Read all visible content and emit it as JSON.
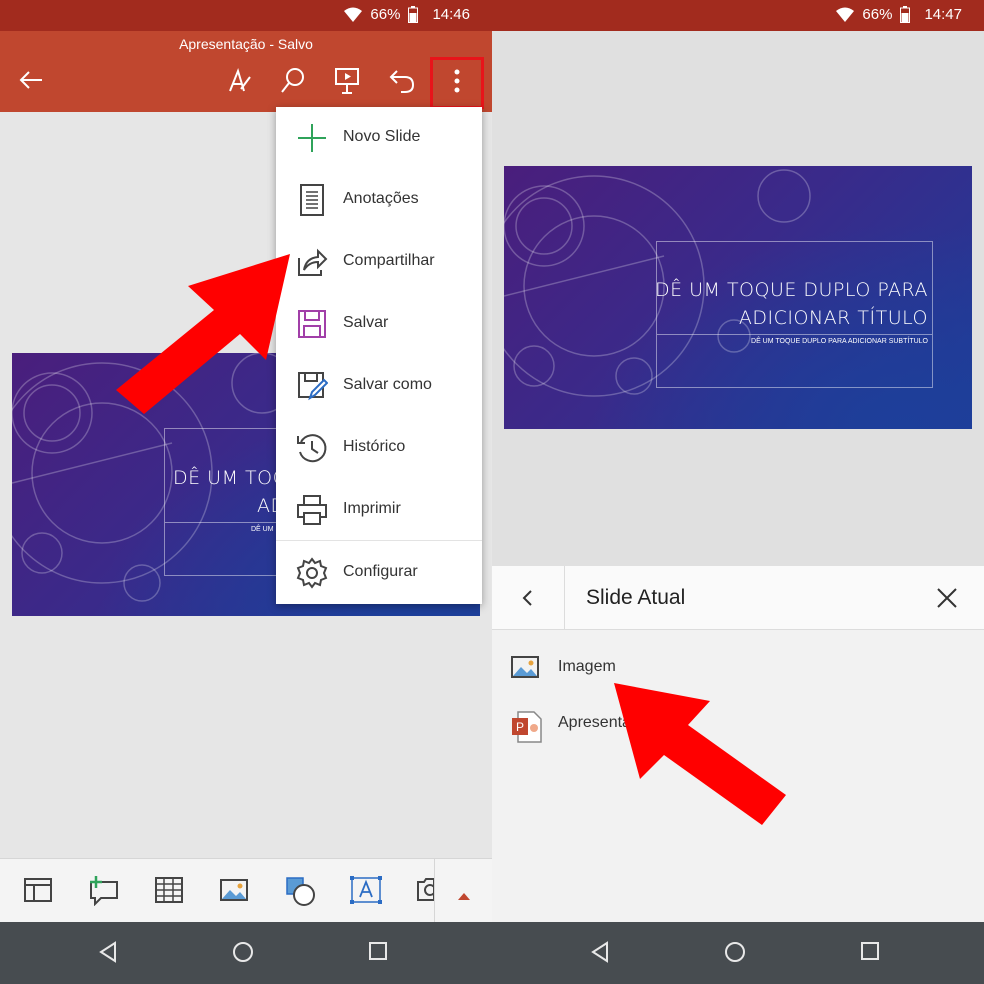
{
  "left_screen": {
    "status_bar": {
      "battery": "66%",
      "time": "14:46"
    },
    "app_bar": {
      "doc_title": "Apresentação - Salvo"
    },
    "slide": {
      "title_line1": "DÊ UM TOC",
      "title_line2": "AD",
      "subtitle": "DÊ UM"
    },
    "menu": {
      "items": [
        {
          "label": "Novo Slide",
          "icon": "plus-icon"
        },
        {
          "label": "Anotações",
          "icon": "notes-icon"
        },
        {
          "label": "Compartilhar",
          "icon": "share-icon"
        },
        {
          "label": "Salvar",
          "icon": "save-icon"
        },
        {
          "label": "Salvar como",
          "icon": "save-as-icon"
        },
        {
          "label": "Histórico",
          "icon": "history-icon"
        },
        {
          "label": "Imprimir",
          "icon": "print-icon"
        },
        {
          "label": "Configurar",
          "icon": "gear-icon"
        }
      ]
    },
    "bottom_toolbar": [
      "layout-icon",
      "new-comment-icon",
      "table-icon",
      "picture-icon",
      "shapes-icon",
      "text-box-icon",
      "camera-icon",
      "collapse-up-icon"
    ]
  },
  "right_screen": {
    "status_bar": {
      "battery": "66%",
      "time": "14:47"
    },
    "slide": {
      "title_line1": "DÊ UM TOQUE DUPLO PARA",
      "title_line2": "ADICIONAR TÍTULO",
      "subtitle": "DÊ UM TOQUE DUPLO PARA ADICIONAR SUBTÍTULO"
    },
    "panel": {
      "title": "Slide Atual",
      "options": [
        {
          "label": "Imagem",
          "icon": "image-icon"
        },
        {
          "label": "Apresenta",
          "icon": "powerpoint-icon"
        }
      ]
    }
  },
  "colors": {
    "status_bar": "#a22b1e",
    "app_bar": "#c0472f",
    "highlight": "#e8141a",
    "arrow": "#ff0000",
    "nav_bar": "#474c50"
  }
}
